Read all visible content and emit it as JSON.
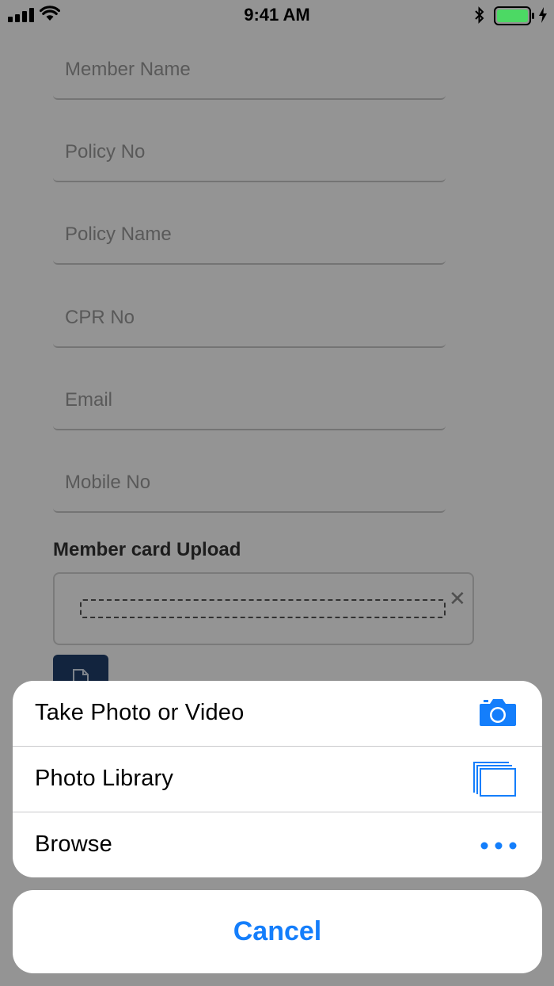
{
  "status_bar": {
    "time": "9:41 AM"
  },
  "form": {
    "fields": [
      {
        "placeholder": "Member Name",
        "value": ""
      },
      {
        "placeholder": "Policy No",
        "value": ""
      },
      {
        "placeholder": "Policy Name",
        "value": ""
      },
      {
        "placeholder": "CPR No",
        "value": ""
      },
      {
        "placeholder": "Email",
        "value": ""
      },
      {
        "placeholder": "Mobile No",
        "value": ""
      }
    ],
    "upload_label": "Member card Upload",
    "remove_glyph": "✕"
  },
  "action_sheet": {
    "items": [
      {
        "label": "Take Photo or Video",
        "icon": "camera-icon"
      },
      {
        "label": "Photo Library",
        "icon": "photo-library-icon"
      },
      {
        "label": "Browse",
        "icon": "more-icon"
      }
    ],
    "cancel_label": "Cancel"
  },
  "colors": {
    "accent": "#147efb",
    "upload_button": "#1f3f6b",
    "battery": "#4cd964"
  }
}
